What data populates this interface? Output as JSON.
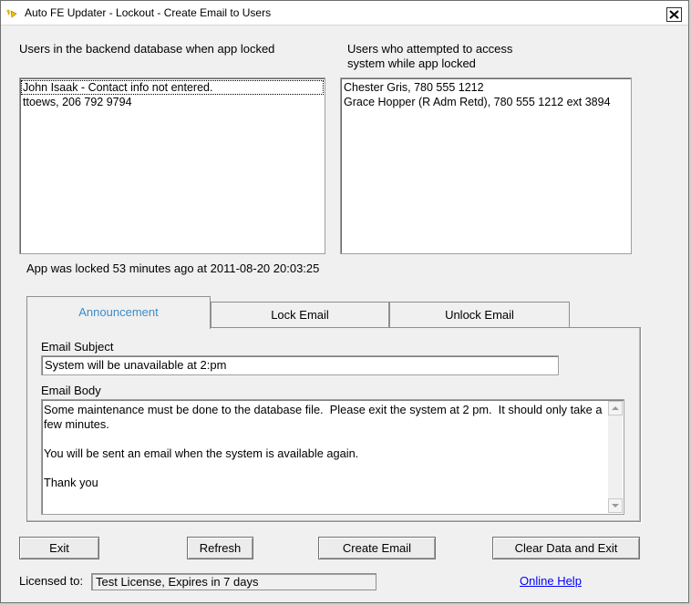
{
  "window": {
    "title": "Auto FE Updater - Lockout - Create Email to Users"
  },
  "backend_users": {
    "label": "Users in the backend database when app locked",
    "items": [
      "John Isaak - Contact info not entered.",
      "ttoews, 206 792 9794"
    ]
  },
  "attempted_users": {
    "label_line1": "Users who attempted to access",
    "label_line2": "system while app locked",
    "items": [
      "Chester Gris, 780 555 1212",
      "Grace Hopper (R Adm Retd), 780 555 1212 ext 3894"
    ]
  },
  "lock_status": "App was locked 53 minutes ago at 2011-08-20 20:03:25",
  "tabs": [
    {
      "label": "Announcement",
      "active": true
    },
    {
      "label": "Lock Email",
      "active": false
    },
    {
      "label": "Unlock Email",
      "active": false
    }
  ],
  "email": {
    "subject_label": "Email Subject",
    "subject_value": "System will be unavailable at 2:pm",
    "body_label": "Email Body",
    "body_value": "Some maintenance must be done to the database file.  Please exit the system at 2 pm.  It should only take a few minutes.\n\nYou will be sent an email when the system is available again.\n\nThank you"
  },
  "buttons": {
    "exit": "Exit",
    "refresh": "Refresh",
    "create_email": "Create Email",
    "clear_exit": "Clear Data and Exit"
  },
  "license": {
    "label": "Licensed to:",
    "value": "Test License, Expires in 7 days"
  },
  "help_link": "Online Help",
  "colors": {
    "active_tab_text": "#3c8dca",
    "link": "#0000ff"
  }
}
